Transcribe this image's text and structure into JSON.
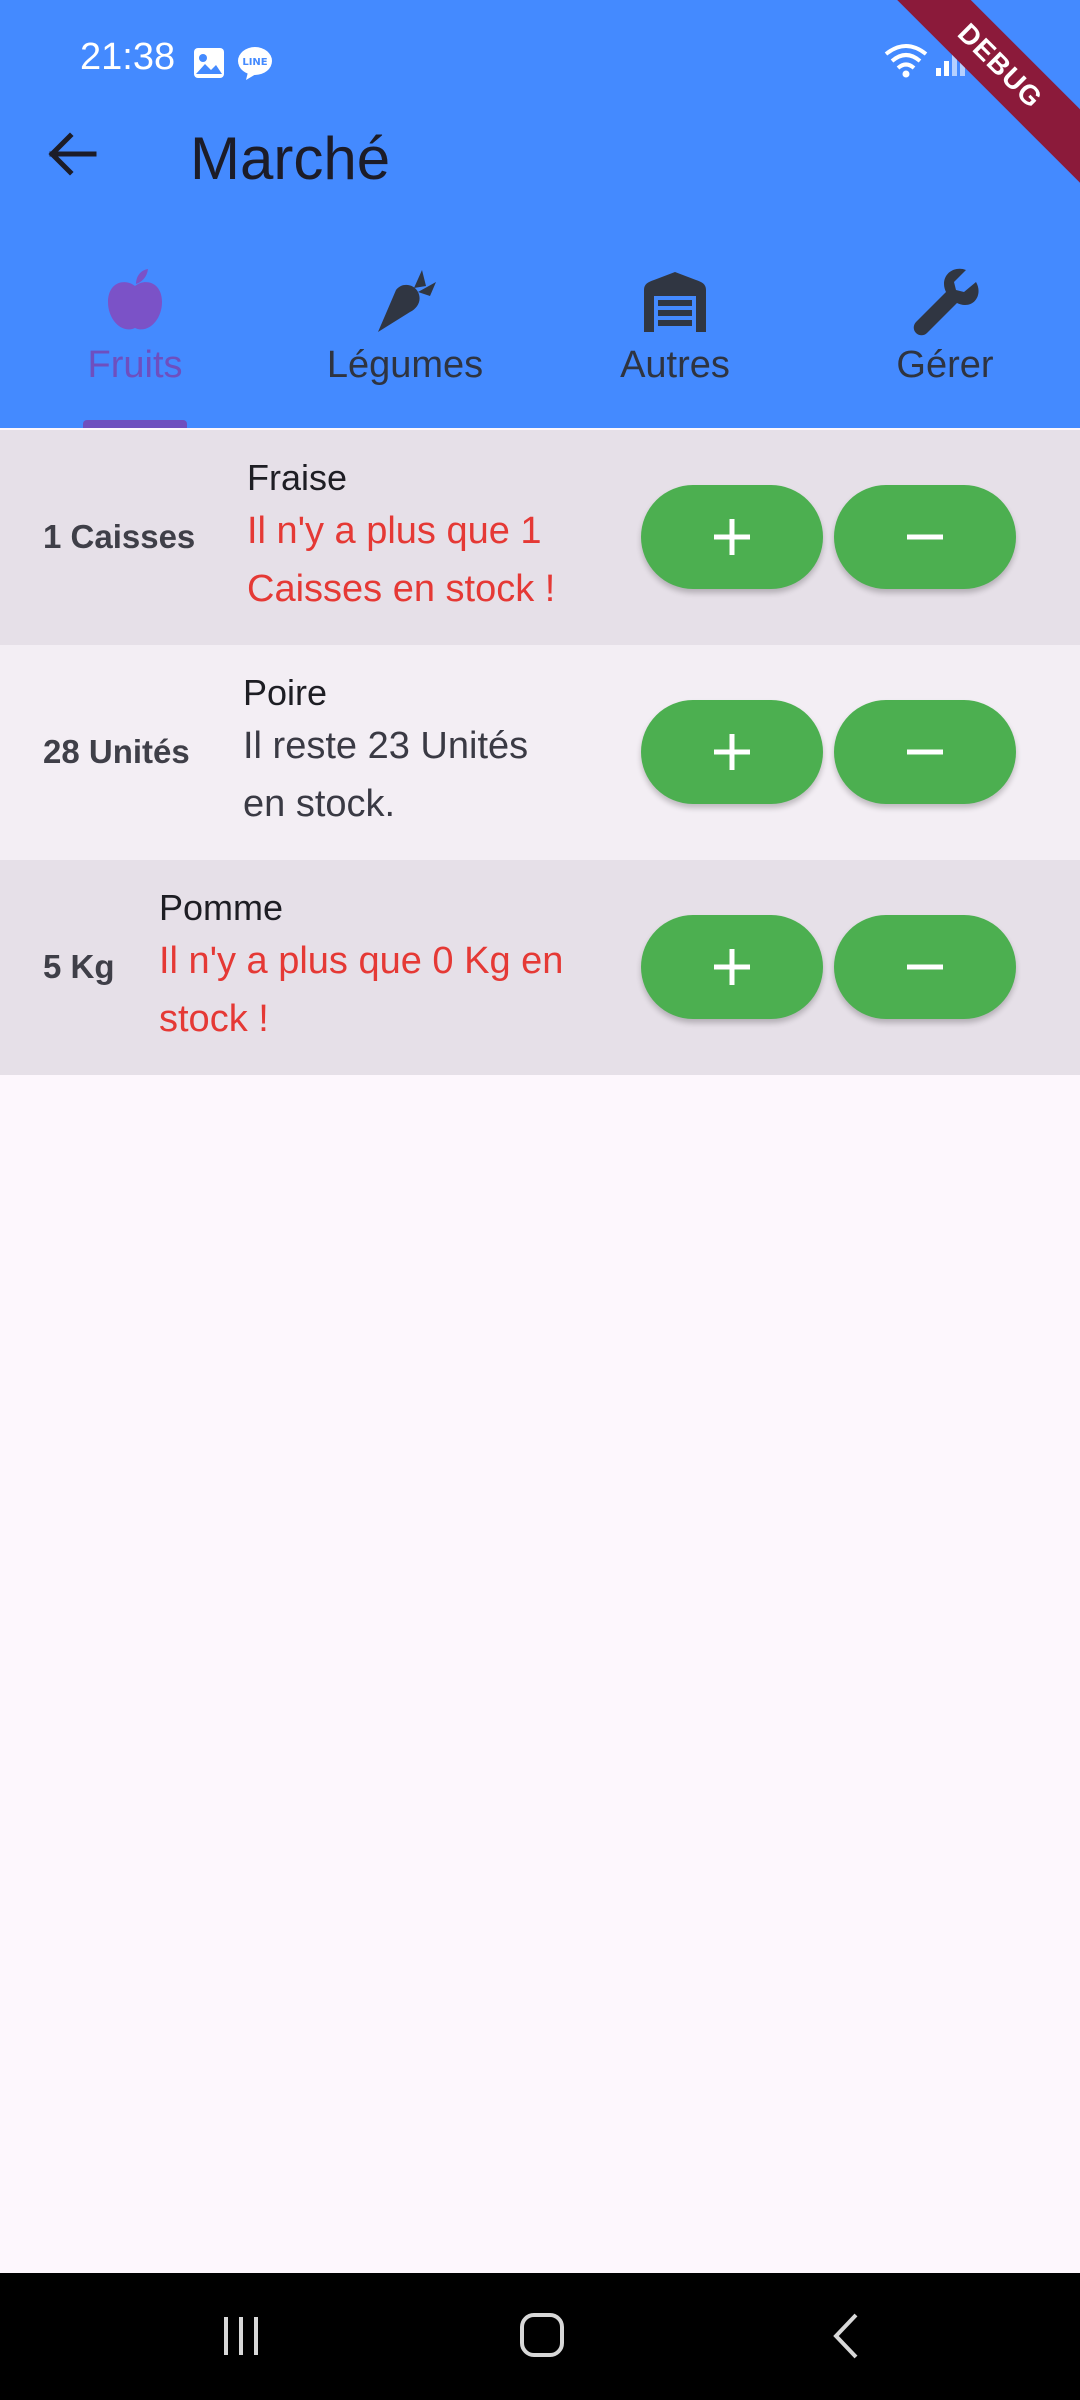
{
  "status_bar": {
    "time": "21:38",
    "icons": [
      "gallery-icon",
      "line-icon",
      "wifi-icon",
      "signal-icon",
      "battery-icon"
    ]
  },
  "debug_banner": "DEBUG",
  "toolbar": {
    "title": "Marché",
    "back_icon": "arrow-left-icon"
  },
  "tabs": [
    {
      "label": "Fruits",
      "icon": "apple-icon",
      "active": true
    },
    {
      "label": "Légumes",
      "icon": "carrot-icon",
      "active": false
    },
    {
      "label": "Autres",
      "icon": "warehouse-icon",
      "active": false
    },
    {
      "label": "Gérer",
      "icon": "wrench-icon",
      "active": false
    }
  ],
  "items": [
    {
      "quantity": "1 Caisses",
      "name": "Fraise",
      "message_line1": "Il n'y a plus que 1",
      "message_line2": "Caisses en stock !",
      "warning": true
    },
    {
      "quantity": "28 Unités",
      "name": "Poire",
      "message_line1": "Il reste 23 Unités",
      "message_line2": "en stock.",
      "warning": false
    },
    {
      "quantity": "5 Kg",
      "name": "Pomme",
      "message_line1": "Il n'y a plus que 0 Kg en",
      "message_line2": "stock !",
      "warning": true
    }
  ],
  "colors": {
    "appbar": "#448aff",
    "accent": "#6e4fbf",
    "button": "#4caf50",
    "warning": "#e53935",
    "row_dark": "#e6e0e8",
    "row_light": "#f3eef4"
  },
  "nav_bar": [
    "recents-icon",
    "home-icon",
    "back-icon"
  ]
}
